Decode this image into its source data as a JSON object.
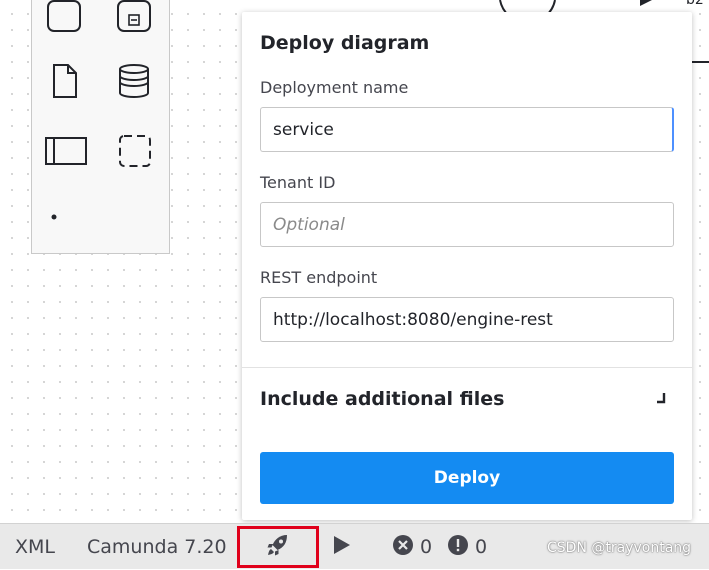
{
  "dialog": {
    "title": "Deploy diagram",
    "deployment_name": {
      "label": "Deployment name",
      "value": "service"
    },
    "tenant_id": {
      "label": "Tenant ID",
      "placeholder": "Optional"
    },
    "rest_endpoint": {
      "label": "REST endpoint",
      "value": "http://localhost:8080/engine-rest"
    },
    "additional_files": {
      "label": "Include additional files"
    },
    "deploy_label": "Deploy"
  },
  "diagram": {
    "fragment_label": "b2"
  },
  "statusbar": {
    "xml_label": "XML",
    "engine_label": "Camunda 7.20",
    "error_count": "0",
    "warning_count": "0"
  },
  "watermark": "CSDN @trayvontang",
  "colors": {
    "accent": "#148bf2",
    "highlight_box": "#e0001b",
    "statusbar_bg": "#e9e9e9"
  },
  "icons": {
    "deploy": "rocket-icon",
    "run": "play-icon",
    "errors": "error-icon",
    "warnings": "warning-icon"
  }
}
